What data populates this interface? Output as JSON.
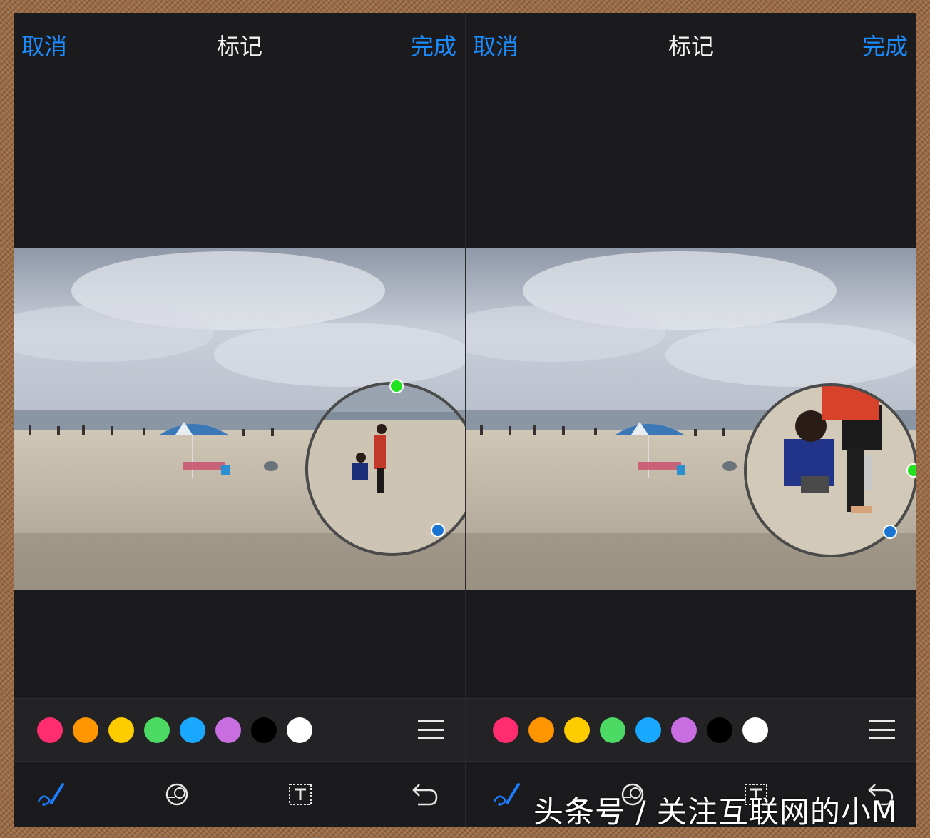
{
  "screens": [
    {
      "nav": {
        "cancel": "取消",
        "title": "标记",
        "done": "完成"
      },
      "magnifier": {
        "view": "normal"
      }
    },
    {
      "nav": {
        "cancel": "取消",
        "title": "标记",
        "done": "完成"
      },
      "magnifier": {
        "view": "zoomed"
      }
    }
  ],
  "palette": {
    "colors": [
      "#ff2d6f",
      "#ff9500",
      "#ffcc00",
      "#4cd964",
      "#1aa8ff",
      "#c86ee0",
      "#000000",
      "#ffffff"
    ],
    "menu_icon": "menu-icon"
  },
  "toolbar": {
    "icons": [
      "pen-icon",
      "magnifier-icon",
      "text-box-icon",
      "undo-icon"
    ],
    "active_color": "#1a7cff"
  },
  "watermark": "头条号 / 关注互联网的小M"
}
